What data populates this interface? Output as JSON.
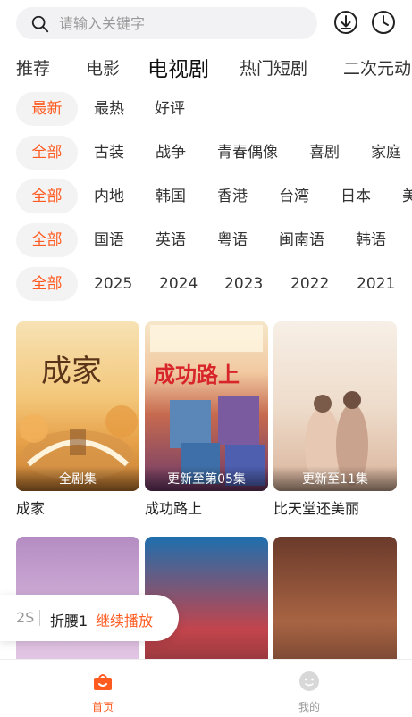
{
  "search": {
    "placeholder": "请输入关键字"
  },
  "tabs": [
    {
      "label": "推荐"
    },
    {
      "label": "电影"
    },
    {
      "label": "电视剧"
    },
    {
      "label": "热门短剧"
    },
    {
      "label": "二次元动"
    }
  ],
  "filters": {
    "sort": [
      "最新",
      "最热",
      "好评"
    ],
    "genre": [
      "全部",
      "古装",
      "战争",
      "青春偶像",
      "喜剧",
      "家庭"
    ],
    "region": [
      "全部",
      "内地",
      "韩国",
      "香港",
      "台湾",
      "日本",
      "美"
    ],
    "language": [
      "全部",
      "国语",
      "英语",
      "粤语",
      "闽南语",
      "韩语"
    ],
    "year": [
      "全部",
      "2025",
      "2024",
      "2023",
      "2022",
      "2021"
    ]
  },
  "cards": [
    {
      "title": "成家",
      "badge": "全剧集",
      "poster_text": "成家"
    },
    {
      "title": "成功路上",
      "badge": "更新至第05集",
      "poster_text": "成功路上"
    },
    {
      "title": "比天堂还美丽",
      "badge": "更新至11集",
      "poster_text": ""
    },
    {
      "title": "",
      "badge": "",
      "poster_text": ""
    },
    {
      "title": "",
      "badge": "",
      "poster_text": ""
    },
    {
      "title": "",
      "badge": "",
      "poster_text": ""
    }
  ],
  "history": {
    "episode": "2S",
    "name": "折腰1",
    "action": "继续播放"
  },
  "nav": [
    {
      "label": "首页"
    },
    {
      "label": "我的"
    }
  ],
  "colors": {
    "accent": "#ff5a1f",
    "chip_bg": "#f3f3f3"
  }
}
